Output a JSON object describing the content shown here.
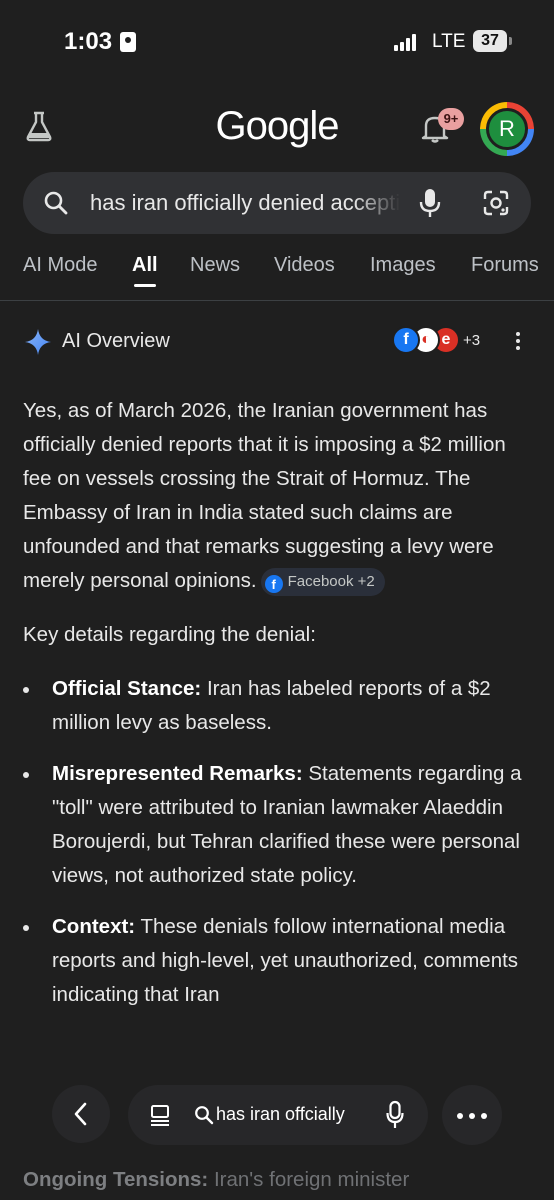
{
  "status_bar": {
    "time": "1:03",
    "network": "LTE",
    "battery": "37"
  },
  "header": {
    "logo": "Google",
    "notification_badge": "9+",
    "avatar_letter": "R"
  },
  "search": {
    "query": "has iran officially denied accepting"
  },
  "tabs": [
    {
      "label": "AI Mode",
      "active": false
    },
    {
      "label": "All",
      "active": true
    },
    {
      "label": "News",
      "active": false
    },
    {
      "label": "Videos",
      "active": false
    },
    {
      "label": "Images",
      "active": false
    },
    {
      "label": "Forums",
      "active": false
    }
  ],
  "ai_overview": {
    "title": "AI Overview",
    "sources_more": "+3",
    "source_icons": [
      "facebook-icon",
      "news-source-icon",
      "youtube-source-icon"
    ],
    "paragraph": "Yes, as of March 2026, the Iranian government has officially denied reports that it is imposing a $2 million fee on vessels crossing the Strait of Hormuz. The Embassy of Iran in India stated such claims are unfounded and that remarks suggesting a levy were merely personal opinions.",
    "citation_chip": "Facebook +2",
    "lead": "Key details regarding the denial:",
    "bullets": [
      {
        "title": "Official Stance:",
        "text": " Iran has labeled reports of a $2 million levy as baseless."
      },
      {
        "title": "Misrepresented Remarks:",
        "text": " Statements regarding a \"toll\" were attributed to Iranian lawmaker Alaeddin Boroujerdi, but Tehran clarified these were personal views, not authorized state policy."
      },
      {
        "title": "Context:",
        "text": " These denials follow international media reports and high-level, yet unauthorized, comments indicating that Iran"
      }
    ],
    "peek_title": "Ongoing Tensions:",
    "peek_text": " Iran's foreign minister"
  },
  "bottom_bar": {
    "query": "has iran offcially"
  },
  "colors": {
    "background": "#1f1f1f",
    "surface": "#303134",
    "accent_blue": "#4285f4"
  }
}
